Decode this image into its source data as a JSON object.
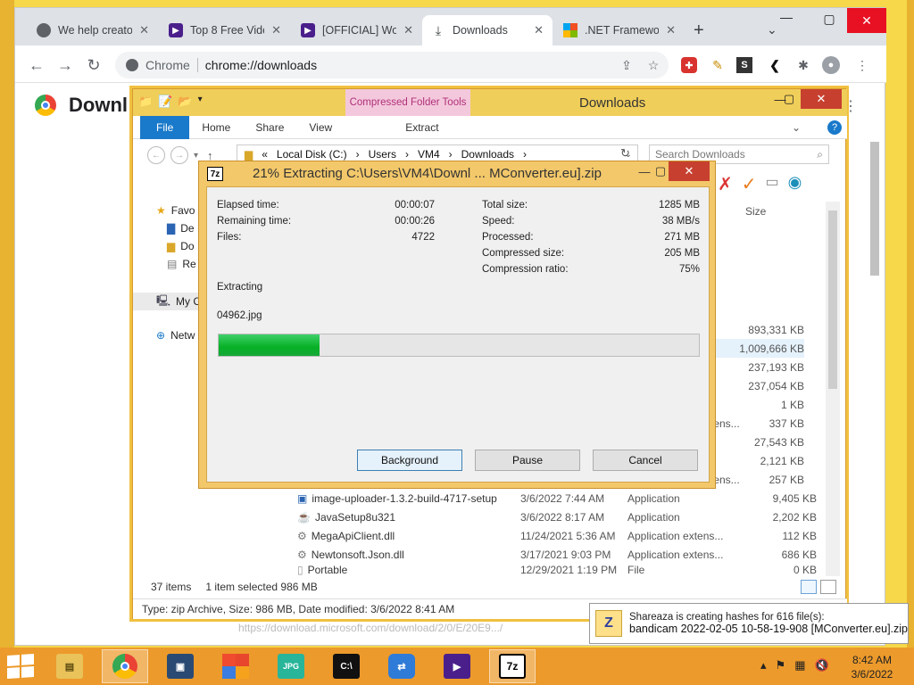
{
  "chrome": {
    "tabs": [
      {
        "title": "We help creato",
        "icon": "globe-icon"
      },
      {
        "title": "Top 8 Free Vide",
        "icon": "purple-app-icon"
      },
      {
        "title": "[OFFICIAL] Wor",
        "icon": "purple-app-icon"
      },
      {
        "title": "Downloads",
        "icon": "download-icon"
      },
      {
        "title": ".NET Framewo",
        "icon": "microsoft-icon"
      }
    ],
    "omnibox_scheme": "Chrome",
    "omnibox_url": "chrome://downloads",
    "page_title": "Downl",
    "bottom_url": "https://download.microsoft.com/download/2/0/E/20E9.../"
  },
  "explorer": {
    "title": "Downloads",
    "context_tab": "Compressed Folder Tools",
    "ribbon_tabs": [
      "File",
      "Home",
      "Share",
      "View"
    ],
    "extract_tab": "Extract",
    "breadcrumb": [
      "«",
      "Local Disk (C:)",
      "›",
      "Users",
      "›",
      "VM4",
      "›",
      "Downloads",
      "›"
    ],
    "search_placeholder": "Search Downloads",
    "nav": [
      {
        "label": "Favo",
        "icon": "star-icon"
      },
      {
        "label": "De",
        "icon": "desktop-icon"
      },
      {
        "label": "Do",
        "icon": "folder-icon"
      },
      {
        "label": "Re",
        "icon": "recent-icon"
      },
      {
        "label": "My C",
        "icon": "computer-icon"
      },
      {
        "label": "Netw",
        "icon": "network-icon"
      }
    ],
    "size_header": "Size",
    "size_cells": [
      "893,331 KB",
      "1,009,666 KB",
      "237,193 KB",
      "237,054 KB",
      "1 KB",
      "337 KB",
      "27,543 KB",
      "2,121 KB",
      "257 KB"
    ],
    "ghost_types": [
      "tens...",
      "tens..."
    ],
    "files": [
      {
        "name": "image-uploader-1.3.2-build-4717-setup",
        "date": "3/6/2022 7:44 AM",
        "type": "Application",
        "size": "9,405 KB"
      },
      {
        "name": "JavaSetup8u321",
        "date": "3/6/2022 8:17 AM",
        "type": "Application",
        "size": "2,202 KB"
      },
      {
        "name": "MegaApiClient.dll",
        "date": "11/24/2021 5:36 AM",
        "type": "Application extens...",
        "size": "112 KB"
      },
      {
        "name": "Newtonsoft.Json.dll",
        "date": "3/17/2021 9:03 PM",
        "type": "Application extens...",
        "size": "686 KB"
      },
      {
        "name": "Portable",
        "date": "12/29/2021 1:19 PM",
        "type": "File",
        "size": "0 KB"
      }
    ],
    "status": {
      "count": "37 items",
      "selected": "1 item selected  986 MB"
    },
    "details": "Type: zip Archive, Size: 986 MB, Date modified: 3/6/2022 8:41 AM"
  },
  "sevenzip": {
    "title": "21% Extracting C:\\Users\\VM4\\Downl ... MConverter.eu].zip",
    "left_stats": [
      {
        "label": "Elapsed time:",
        "value": "00:00:07"
      },
      {
        "label": "Remaining time:",
        "value": "00:00:26"
      },
      {
        "label": "Files:",
        "value": "4722"
      }
    ],
    "right_stats": [
      {
        "label": "Total size:",
        "value": "1285 MB"
      },
      {
        "label": "Speed:",
        "value": "38 MB/s"
      },
      {
        "label": "Processed:",
        "value": "271 MB"
      },
      {
        "label": "Compressed size:",
        "value": "205 MB"
      },
      {
        "label": "Compression ratio:",
        "value": "75%"
      }
    ],
    "operation": "Extracting",
    "current_file": "04962.jpg",
    "progress": 0.21,
    "buttons": {
      "background": "Background",
      "pause": "Pause",
      "cancel": "Cancel"
    }
  },
  "notification": {
    "line1": "Shareaza is creating hashes for 616 file(s):",
    "line2": "bandicam 2022-02-05 10-58-19-908 [MConverter.eu].zip"
  },
  "taskbar": {
    "apps": [
      "file-explorer-icon",
      "chrome-icon",
      "app-icon",
      "windows-tiles-icon",
      "jpg-viewer-icon",
      "terminal-icon",
      "sync-icon",
      "purple-app-icon",
      "7zip-icon"
    ],
    "time": "8:42 AM",
    "date": "3/6/2022"
  },
  "colors": {
    "accent_blue": "#1979ca",
    "progress_green": "#06b025",
    "taskbar": "#ec9a2b",
    "desktop": "#f6d84a"
  }
}
